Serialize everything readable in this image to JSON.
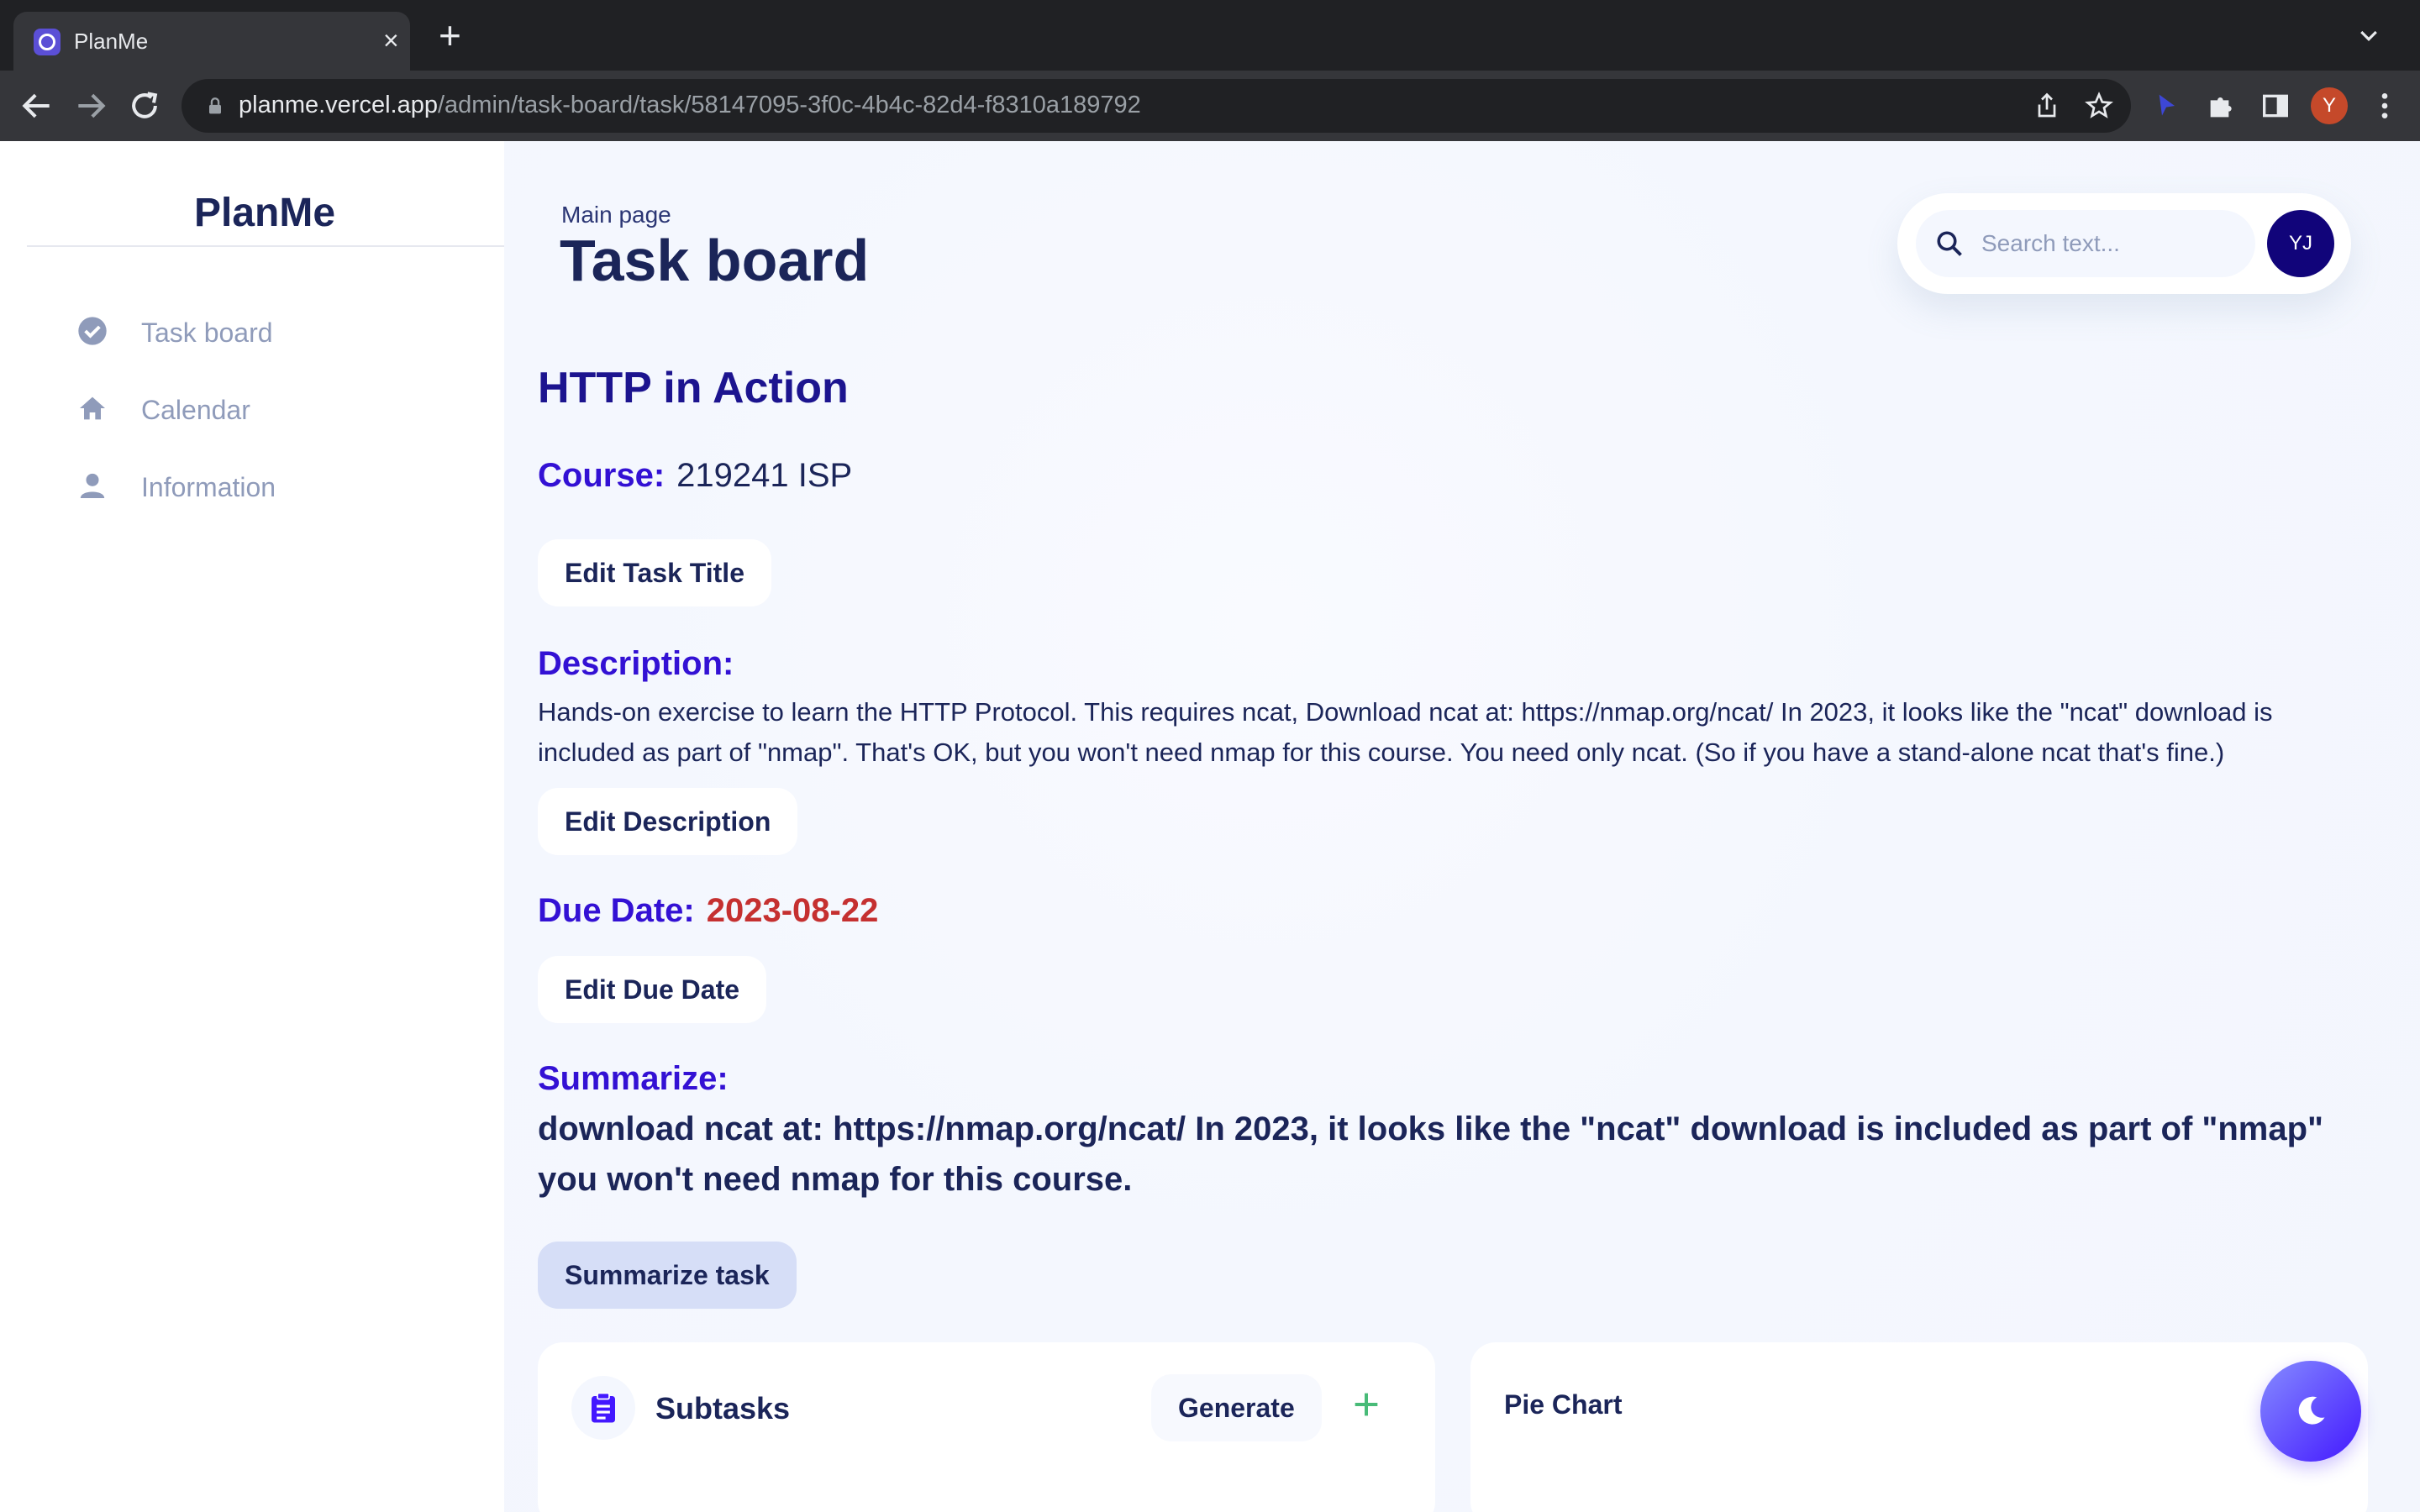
{
  "browser": {
    "tab_title": "PlanMe",
    "url_host": "planme.vercel.app",
    "url_path": "/admin/task-board/task/58147095-3f0c-4b4c-82d4-f8310a189792",
    "profile_initial": "Y"
  },
  "sidebar": {
    "brand": "PlanMe",
    "items": [
      {
        "label": "Task board",
        "icon": "check-circle-icon"
      },
      {
        "label": "Calendar",
        "icon": "home-icon"
      },
      {
        "label": "Information",
        "icon": "person-icon"
      }
    ]
  },
  "header": {
    "breadcrumb": "Main page",
    "title": "Task board",
    "search_placeholder": "Search text...",
    "avatar_initials": "YJ"
  },
  "task": {
    "title": "HTTP in Action",
    "course_label": "Course:",
    "course_value": "219241 ISP",
    "edit_title_label": "Edit Task Title",
    "description_label": "Description:",
    "description_text": "Hands-on exercise to learn the HTTP Protocol. This requires ncat,  Download ncat at: https://nmap.org/ncat/ In 2023, it looks like the \"ncat\" download is included as part of \"nmap\". That's OK, but you won't need nmap for this course. You need only ncat. (So if you have a stand-alone ncat that's fine.)",
    "edit_description_label": "Edit Description",
    "due_label": "Due Date:",
    "due_value": "2023-08-22",
    "edit_due_label": "Edit Due Date",
    "summarize_label": "Summarize:",
    "summary_text": "download ncat at: https://nmap.org/ncat/ In 2023, it looks like the \"ncat\" download is included as part of \"nmap\" you won't need nmap for this course.",
    "summarize_button": "Summarize task"
  },
  "subtasks": {
    "title": "Subtasks",
    "generate_label": "Generate"
  },
  "pie": {
    "title": "Pie Chart"
  },
  "colors": {
    "accent_purple": "#3311d4",
    "title_navy": "#1b2559",
    "due_red": "#c53030",
    "avatar_bg": "#11047a"
  }
}
